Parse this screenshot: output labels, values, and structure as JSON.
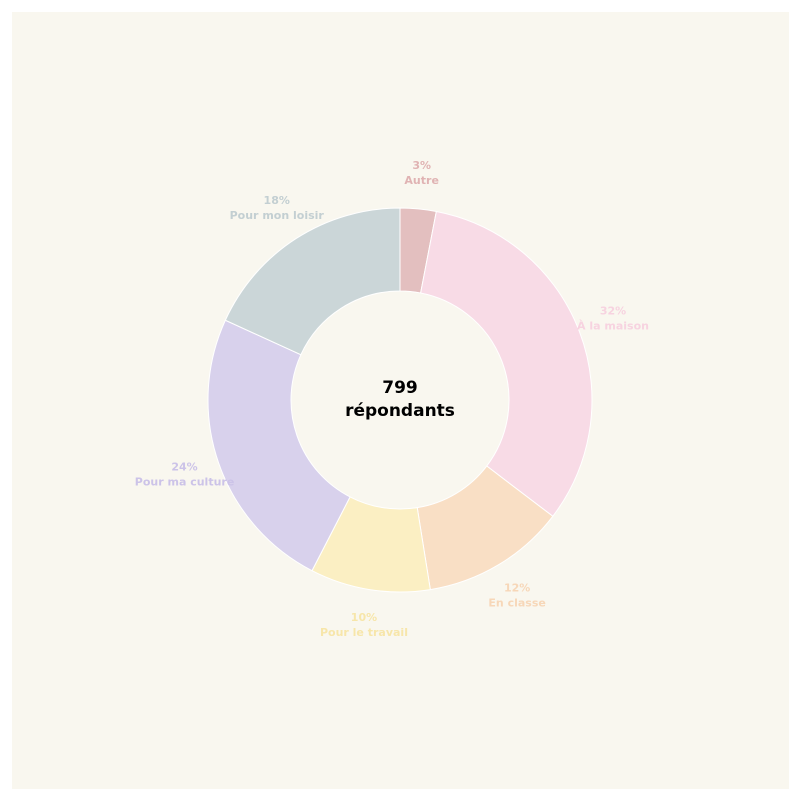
{
  "chart_data": {
    "type": "pie",
    "donut": true,
    "center_label": {
      "line1": "799",
      "line2": "répondants"
    },
    "slices": [
      {
        "name": "Autre",
        "value": 3,
        "label": "3%",
        "color": "#e3bfbf",
        "label_color": "#e0b3b3"
      },
      {
        "name": "À la maison",
        "value": 32,
        "label": "32%",
        "color": "#f8dbe6",
        "label_color": "#f7d3e0"
      },
      {
        "name": "En classe",
        "value": 12,
        "label": "12%",
        "color": "#f9dfc5",
        "label_color": "#f7d7b8"
      },
      {
        "name": "Pour le travail",
        "value": 10,
        "label": "10%",
        "color": "#fbefc3",
        "label_color": "#f7e6aa"
      },
      {
        "name": "Pour ma culture",
        "value": 24,
        "label": "24%",
        "color": "#d8d1ec",
        "label_color": "#ccc3e8"
      },
      {
        "name": "Pour mon loisir",
        "value": 18,
        "label": "18%",
        "color": "#cbd6d8",
        "label_color": "#c3cfd2"
      }
    ]
  },
  "colors": {
    "background": "#f9f7ef"
  }
}
